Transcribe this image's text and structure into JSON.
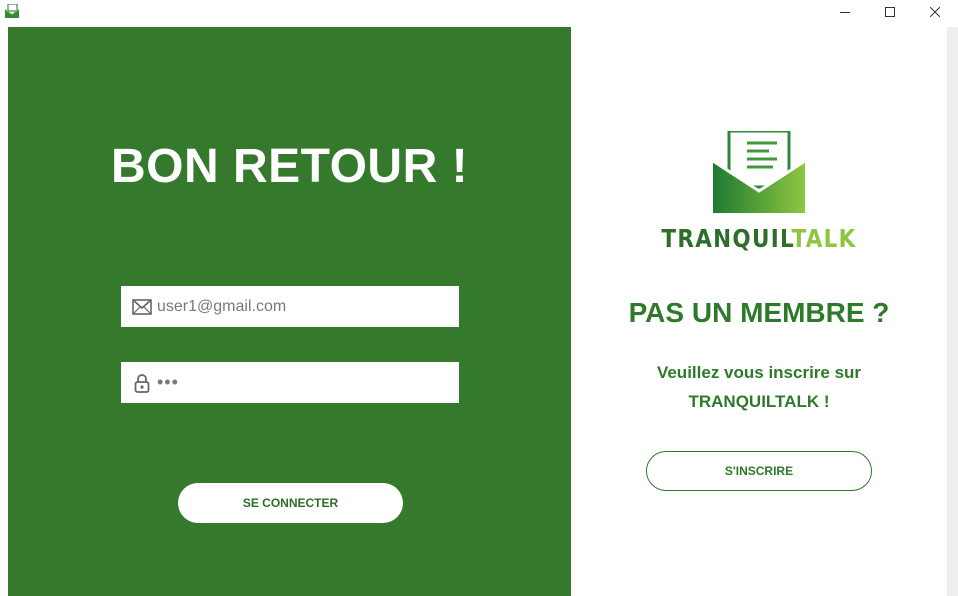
{
  "window": {
    "icon": "envelope-app-icon",
    "controls": {
      "minimize": "minimize-icon",
      "maximize": "maximize-icon",
      "close": "close-icon"
    }
  },
  "login": {
    "title": "BON RETOUR !",
    "email": {
      "value": "user1@gmail.com",
      "icon": "envelope-icon"
    },
    "password": {
      "value": "•••",
      "icon": "lock-icon"
    },
    "submit_label": "SE CONNECTER"
  },
  "signup": {
    "brand_primary": "TRANQUIL",
    "brand_accent": "TALK",
    "heading": "PAS UN MEMBRE ?",
    "message_line1": "Veuillez vous inscrire sur",
    "message_line2": "TRANQUILTALK !",
    "button_label": "S'INSCRIRE"
  },
  "colors": {
    "primary_green": "#357a2c",
    "text_green": "#2f7a2a",
    "accent_green": "#8ec63f",
    "white": "#ffffff"
  }
}
